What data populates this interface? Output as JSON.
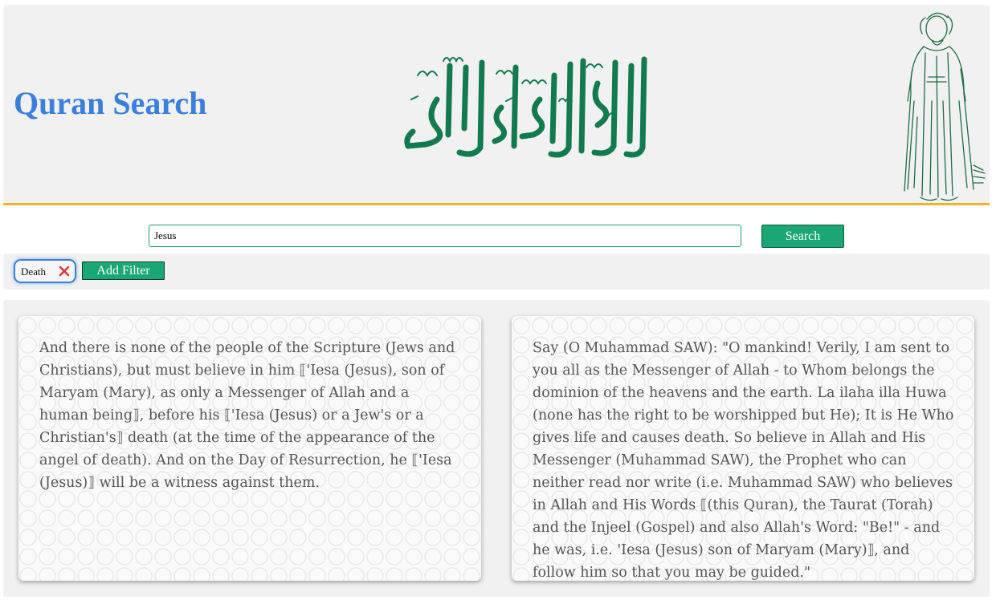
{
  "header": {
    "title": "Quran Search",
    "calligraphy_icon": "shahada-calligraphy-icon",
    "figure_icon": "praying-man-illustration",
    "accent_color": "#f0b429",
    "title_color": "#3b7fdc",
    "calligraphy_color": "#127a4f"
  },
  "search": {
    "query": "Jesus",
    "placeholder": "",
    "button_label": "Search",
    "button_color": "#1aa773"
  },
  "filters": {
    "active": [
      {
        "label": "Death",
        "remove_icon": "close-x-icon"
      }
    ],
    "add_label": "Add Filter"
  },
  "results": [
    {
      "text": "And there is none of the people of the Scripture (Jews and Christians), but must believe in him ⟦'Iesa (Jesus), son of Maryam (Mary), as only a Messenger of Allah and a human being⟧, before his ⟦'Iesa (Jesus) or a Jew's or a Christian's⟧ death (at the time of the appearance of the angel of death). And on the Day of Resurrection, he ⟦'Iesa (Jesus)⟧ will be a witness against them."
    },
    {
      "text": "Say (O Muhammad SAW): \"O mankind! Verily, I am sent to you all as the Messenger of Allah - to Whom belongs the dominion of the heavens and the earth. La ilaha illa Huwa (none has the right to be worshipped but He); It is He Who gives life and causes death. So believe in Allah and His Messenger (Muhammad SAW), the Prophet who can neither read nor write (i.e. Muhammad SAW) who believes in Allah and His Words ⟦(this Quran), the Taurat (Torah) and the Injeel (Gospel) and also Allah's Word: \"Be!\" - and he was, i.e. 'Iesa (Jesus) son of Maryam (Mary)⟧, and follow him so that you may be guided.\""
    }
  ]
}
